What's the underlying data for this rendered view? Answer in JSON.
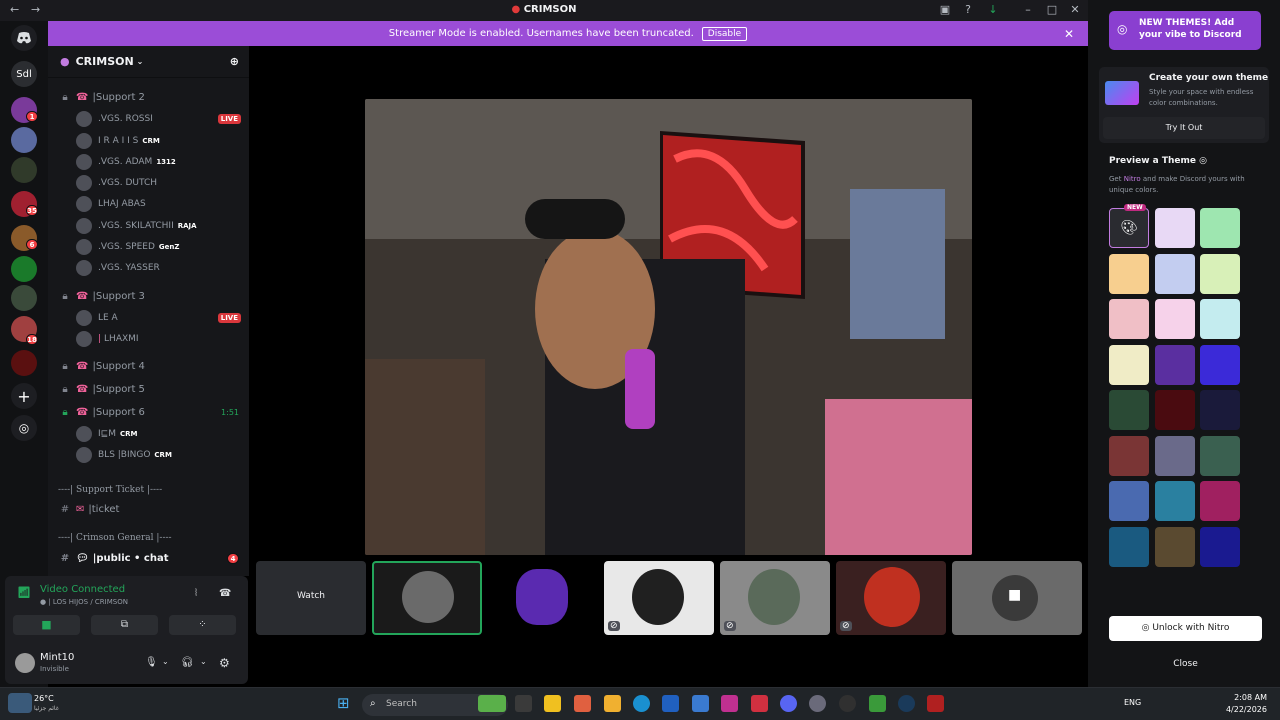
{
  "window": {
    "title": "CRIMSON"
  },
  "banner": {
    "text": "Streamer Mode is enabled. Usernames have been truncated.",
    "button": "Disable"
  },
  "guilds": {
    "label_sdl": "Sdl",
    "badges": [
      "1",
      "35",
      "6",
      "18"
    ]
  },
  "server": {
    "name": "CRIMSON"
  },
  "channels": [
    {
      "name": "Support 2",
      "users": [
        {
          "name": "ROSSI",
          "tag": "",
          "live": "LIVE"
        },
        {
          "name": "I R A I I S",
          "tag": "CRM",
          "live": ""
        },
        {
          "name": "ADAM",
          "tag": "1312",
          "live": ""
        },
        {
          "name": "DUTCH",
          "tag": "",
          "live": ""
        },
        {
          "name": "LHAJ ABAS",
          "tag": "",
          "live": ""
        },
        {
          "name": "SKILATCHII",
          "tag": "RAJA",
          "live": ""
        },
        {
          "name": "SPEED",
          "tag": "GenZ",
          "live": ""
        },
        {
          "name": "YASSER",
          "tag": "",
          "live": ""
        }
      ]
    },
    {
      "name": "Support 3",
      "users": [
        {
          "name": "LE A",
          "tag": "",
          "live": "LIVE"
        },
        {
          "name": "LHAXMI",
          "tag": "",
          "live": ""
        }
      ]
    },
    {
      "name": "Support 4"
    },
    {
      "name": "Support 5"
    },
    {
      "name": "Support 6",
      "timer": "1:51",
      "users": [
        {
          "name": "M",
          "tag": "CRM",
          "live": ""
        },
        {
          "name": "BINGO",
          "tag": "CRM",
          "live": ""
        }
      ]
    }
  ],
  "categories": {
    "support_ticket": "----| Support Ticket |---- ",
    "crimson_general": "----| Crimson General |---- "
  },
  "text_channels": {
    "ticket": "ticket",
    "public_chat": "public • chat",
    "public_badge": "4"
  },
  "voice": {
    "status": "Video Connected",
    "location": "LOS HIJOS / CRIMSON"
  },
  "userbar": {
    "name": "Mint10",
    "status": "Invisible"
  },
  "tiles": {
    "watch": "Watch"
  },
  "theme_panel": {
    "promo": "NEW THEMES! Add your vibe to Discord",
    "create_title": "Create your own theme",
    "create_desc": "Style your space with endless color combinations.",
    "try_button": "Try It Out",
    "preview_title": "Preview a Theme",
    "preview_desc_1": "Get ",
    "preview_desc_nitro": "Nitro",
    "preview_desc_2": " and make Discord yours with unique colors.",
    "new_badge": "NEW",
    "unlock_button": "Unlock with Nitro",
    "close_button": "Close",
    "swatch_colors": [
      "#e8d9f5",
      "#9ee6b0",
      "#f7cf8f",
      "#c3cdf0",
      "#d8f0b8",
      "#f0bfc6",
      "#f6d2ea",
      "#c4ecef",
      "#f0ecc6",
      "#5a2fa0",
      "#3b2ad8",
      "#2a4a35",
      "#4a0b10",
      "#1a1a3a",
      "#7a3535",
      "#6a6a8a",
      "#3a6050",
      "#4a6ab0",
      "#2a80a0",
      "#a02060",
      "#1a5a80",
      "#5a4a30",
      "#1a1a90"
    ]
  },
  "taskbar": {
    "weather_temp": "26°C",
    "weather_desc": "غائم جزئيا",
    "search": "Search",
    "lang": "ENG",
    "time": "2:08 AM",
    "date": "4/22/2026"
  }
}
